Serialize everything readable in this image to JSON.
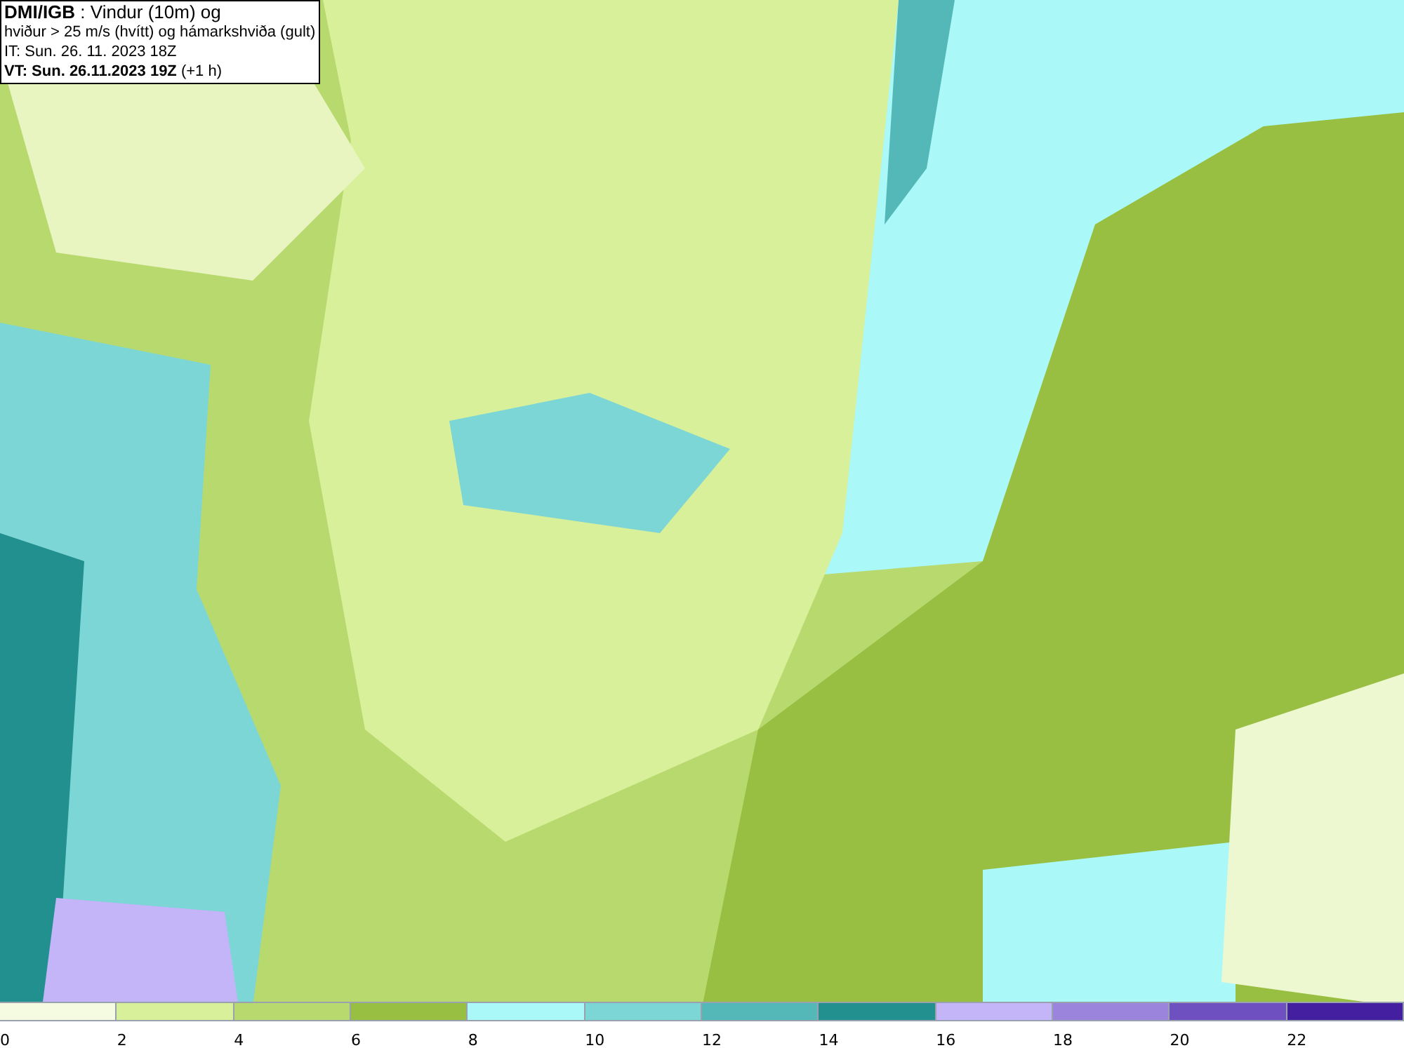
{
  "title_box": {
    "lines": [
      "**DMI/IGB** : Vindur (10m) og",
      "hviður > 25 m/s (hvítt) og hámarkshviða (gult)",
      "IT: Sun. 26. 11. 2023 18Z",
      "**VT: Sun. 26.11.2023 19Z** (+1 h)"
    ]
  },
  "legend": [
    {
      "label": "0",
      "color": "#f5fbe0"
    },
    {
      "label": "2",
      "color": "#d8f09a"
    },
    {
      "label": "4",
      "color": "#b8d96e"
    },
    {
      "label": "6",
      "color": "#98bf41"
    },
    {
      "label": "8",
      "color": "#aaf8f8"
    },
    {
      "label": "10",
      "color": "#7dd6d6"
    },
    {
      "label": "12",
      "color": "#55b8b8"
    },
    {
      "label": "14",
      "color": "#239090"
    },
    {
      "label": "16",
      "color": "#c4b4f8"
    },
    {
      "label": "18",
      "color": "#9a84dc"
    },
    {
      "label": "20",
      "color": "#6e50c0"
    },
    {
      "label": "22",
      "color": "#4420a0"
    }
  ]
}
